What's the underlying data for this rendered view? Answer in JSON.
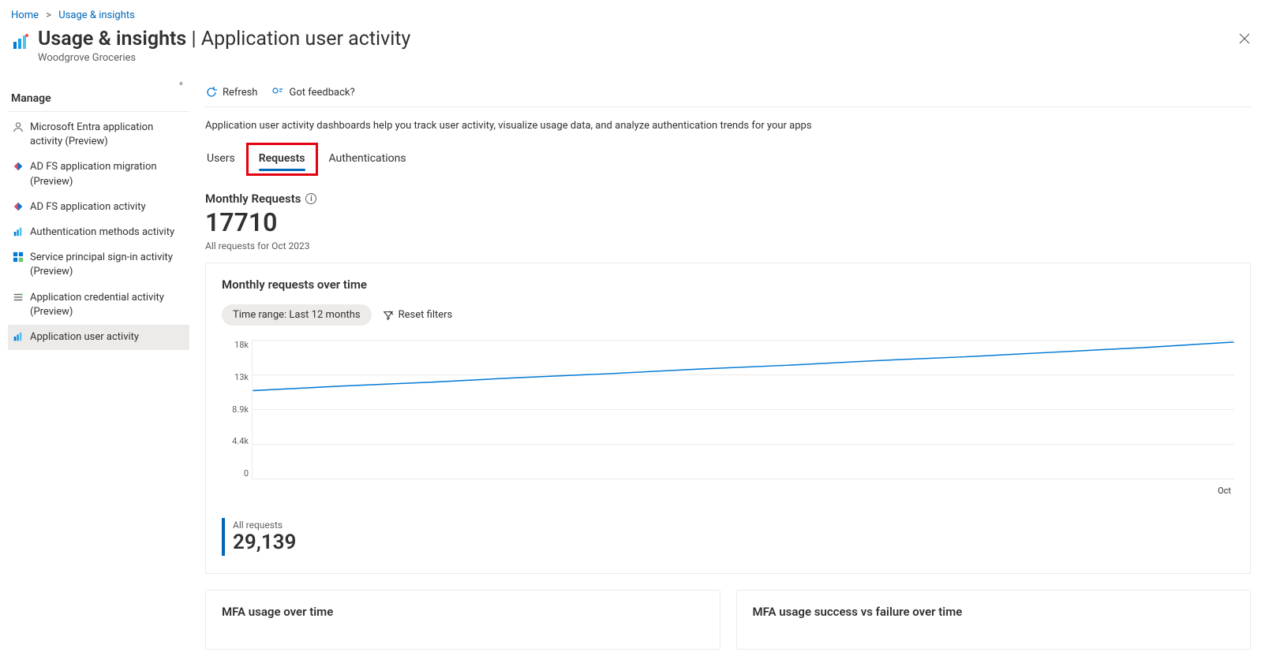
{
  "breadcrumb": {
    "home": "Home",
    "section": "Usage & insights"
  },
  "header": {
    "title_bold": "Usage & insights",
    "title_sep": " | ",
    "title_thin": "Application user activity",
    "subtitle": "Woodgrove Groceries"
  },
  "sidebar": {
    "heading": "Manage",
    "items": [
      {
        "label": "Microsoft Entra application activity (Preview)"
      },
      {
        "label": "AD FS application migration (Preview)"
      },
      {
        "label": "AD FS application activity"
      },
      {
        "label": "Authentication methods activity"
      },
      {
        "label": "Service principal sign-in activity (Preview)"
      },
      {
        "label": "Application credential activity (Preview)"
      },
      {
        "label": "Application user activity"
      }
    ]
  },
  "toolbar": {
    "refresh": "Refresh",
    "feedback": "Got feedback?"
  },
  "description": "Application user activity dashboards help you track user activity, visualize usage data, and analyze authentication trends for your apps",
  "tabs": {
    "users": "Users",
    "requests": "Requests",
    "authentications": "Authentications"
  },
  "kpi": {
    "label": "Monthly Requests",
    "value": "17710",
    "sub": "All requests for Oct 2023"
  },
  "chart_card": {
    "title": "Monthly requests over time",
    "time_range_pill": "Time range: Last 12 months",
    "reset_filters": "Reset filters",
    "x_tick": "Oct",
    "summary_label": "All requests",
    "summary_value": "29,139"
  },
  "bottom_cards": {
    "mfa_usage": "MFA usage over time",
    "mfa_success": "MFA usage success vs failure over time"
  },
  "chart_data": {
    "type": "line",
    "title": "Monthly requests over time",
    "ylabel": "Requests",
    "ylim": [
      0,
      18000
    ],
    "y_ticks": [
      "18k",
      "13k",
      "8.9k",
      "4.4k",
      "0"
    ],
    "x_ticks": [
      "Oct"
    ],
    "series": [
      {
        "name": "All requests",
        "color": "#0078d4",
        "values": [
          11400,
          12000,
          12500,
          13100,
          13600,
          14200,
          14700,
          15300,
          15800,
          16400,
          17000,
          17710
        ]
      }
    ]
  }
}
